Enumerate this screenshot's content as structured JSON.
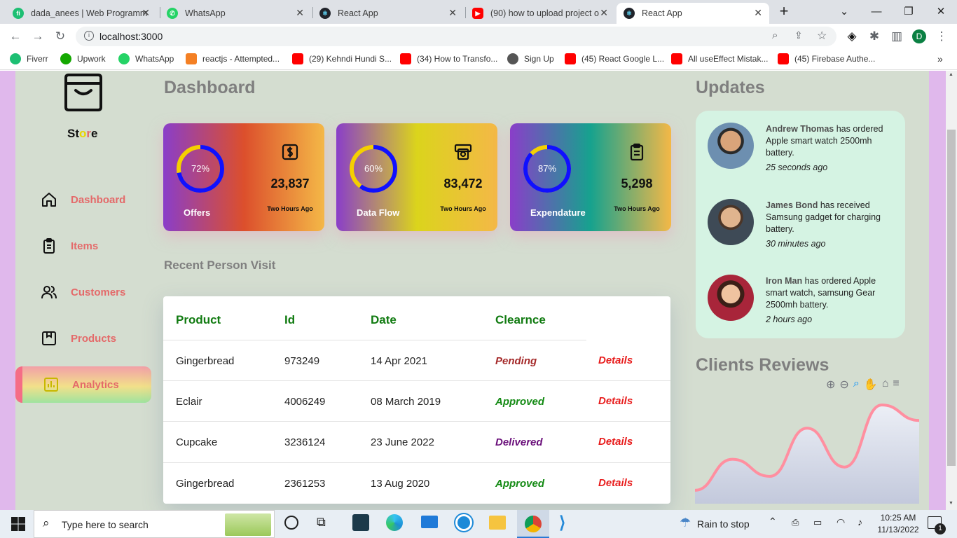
{
  "browser": {
    "tabs": [
      {
        "title": "dada_anees | Web Programm",
        "icon": "fiverr-icon"
      },
      {
        "title": "WhatsApp",
        "icon": "whatsapp-icon"
      },
      {
        "title": "React App",
        "icon": "react-icon"
      },
      {
        "title": "(90) how to upload project o",
        "icon": "youtube-icon"
      },
      {
        "title": "React App",
        "icon": "react-icon",
        "active": true
      }
    ],
    "url": "localhost:3000",
    "profile_initial": "D",
    "bookmarks": [
      {
        "label": "Fiverr",
        "icon": "fiverr-icon",
        "color": "#1dbf73"
      },
      {
        "label": "Upwork",
        "icon": "upwork-icon",
        "color": "#14a800"
      },
      {
        "label": "WhatsApp",
        "icon": "whatsapp-icon",
        "color": "#25d366"
      },
      {
        "label": "reactjs - Attempted...",
        "icon": "stackoverflow-icon",
        "color": "#f48024"
      },
      {
        "label": "(29) Kehndi Hundi S...",
        "icon": "youtube-icon",
        "color": "#ff0000"
      },
      {
        "label": "(34) How to Transfo...",
        "icon": "youtube-icon",
        "color": "#ff0000"
      },
      {
        "label": "Sign Up",
        "icon": "globe-icon",
        "color": "#555555"
      },
      {
        "label": "(45) React Google L...",
        "icon": "youtube-icon",
        "color": "#ff0000"
      },
      {
        "label": "All useEffect Mistak...",
        "icon": "youtube-icon",
        "color": "#ff0000"
      },
      {
        "label": "(45) Firebase Authe...",
        "icon": "youtube-icon",
        "color": "#ff0000"
      }
    ]
  },
  "sidebar": {
    "logo_text": "Store",
    "logo_parts": [
      "St",
      "o",
      "r",
      "e"
    ],
    "items": [
      {
        "label": "Dashboard",
        "icon": "home-icon"
      },
      {
        "label": "Items",
        "icon": "clipboard-icon"
      },
      {
        "label": "Customers",
        "icon": "users-icon"
      },
      {
        "label": "Products",
        "icon": "package-icon"
      },
      {
        "label": "Analytics",
        "icon": "chart-icon",
        "active": true
      }
    ]
  },
  "dashboard": {
    "title": "Dashboard",
    "cards": [
      {
        "title": "Offers",
        "percent": 72,
        "percent_label": "72%",
        "value": "23,837",
        "time": "Two Hours Ago",
        "icon": "dollar-icon"
      },
      {
        "title": "Data Flow",
        "percent": 60,
        "percent_label": "60%",
        "value": "83,472",
        "time": "Two Hours Ago",
        "icon": "money-icon"
      },
      {
        "title": "Expendature",
        "percent": 87,
        "percent_label": "87%",
        "value": "5,298",
        "time": "Two Hours Ago",
        "icon": "clipboard-icon"
      }
    ],
    "recent_title": "Recent Person Visit",
    "table": {
      "headers": [
        "Product",
        "Id",
        "Date",
        "Clearnce"
      ],
      "rows": [
        {
          "product": "Gingerbread",
          "id": "973249",
          "date": "14 Apr 2021",
          "status": "Pending",
          "status_color": "#a52a2a",
          "action": "Details"
        },
        {
          "product": "Eclair",
          "id": "4006249",
          "date": "08 March 2019",
          "status": "Approved",
          "status_color": "#138a13",
          "action": "Details"
        },
        {
          "product": "Cupcake",
          "id": "3236124",
          "date": "23 June 2022",
          "status": "Delivered",
          "status_color": "#6a0f7a",
          "action": "Details"
        },
        {
          "product": "Gingerbread",
          "id": "2361253",
          "date": "13 Aug 2020",
          "status": "Approved",
          "status_color": "#138a13",
          "action": "Details"
        }
      ]
    }
  },
  "updates": {
    "title": "Updates",
    "items": [
      {
        "name": "Andrew Thomas",
        "text": " has ordered Apple smart watch 2500mh battery.",
        "time": "25 seconds ago"
      },
      {
        "name": "James Bond",
        "text": " has received Samsung gadget for charging battery.",
        "time": "30 minutes ago"
      },
      {
        "name": "Iron Man",
        "text": " has ordered Apple smart watch, samsung Gear 2500mh battery.",
        "time": "2 hours ago"
      }
    ]
  },
  "reviews": {
    "title": "Clients Reviews",
    "toolbar_icons": [
      "zoom-in-icon",
      "zoom-out-icon",
      "zoom-icon",
      "pan-icon",
      "reset-home-icon",
      "menu-icon"
    ]
  },
  "chart_data": {
    "type": "area",
    "x": [
      0,
      1,
      2,
      3,
      4,
      5,
      6
    ],
    "series": [
      {
        "values": [
          10,
          50,
          28,
          90,
          40,
          120,
          100
        ]
      }
    ],
    "ylim": [
      0,
      130
    ],
    "grid": false,
    "colors": {
      "line": "#ff8fa0",
      "fill": "#c6cde0"
    }
  },
  "taskbar": {
    "search_placeholder": "Type here to search",
    "weather": "Rain to stop",
    "time": "10:25 AM",
    "date": "11/13/2022",
    "notification_count": "1"
  },
  "colors": {
    "page_bg": "#d4ddd0",
    "outer_bg": "#e0b8ec",
    "accent_text": "#e46a6a",
    "updates_bg": "#d5f3e3"
  }
}
